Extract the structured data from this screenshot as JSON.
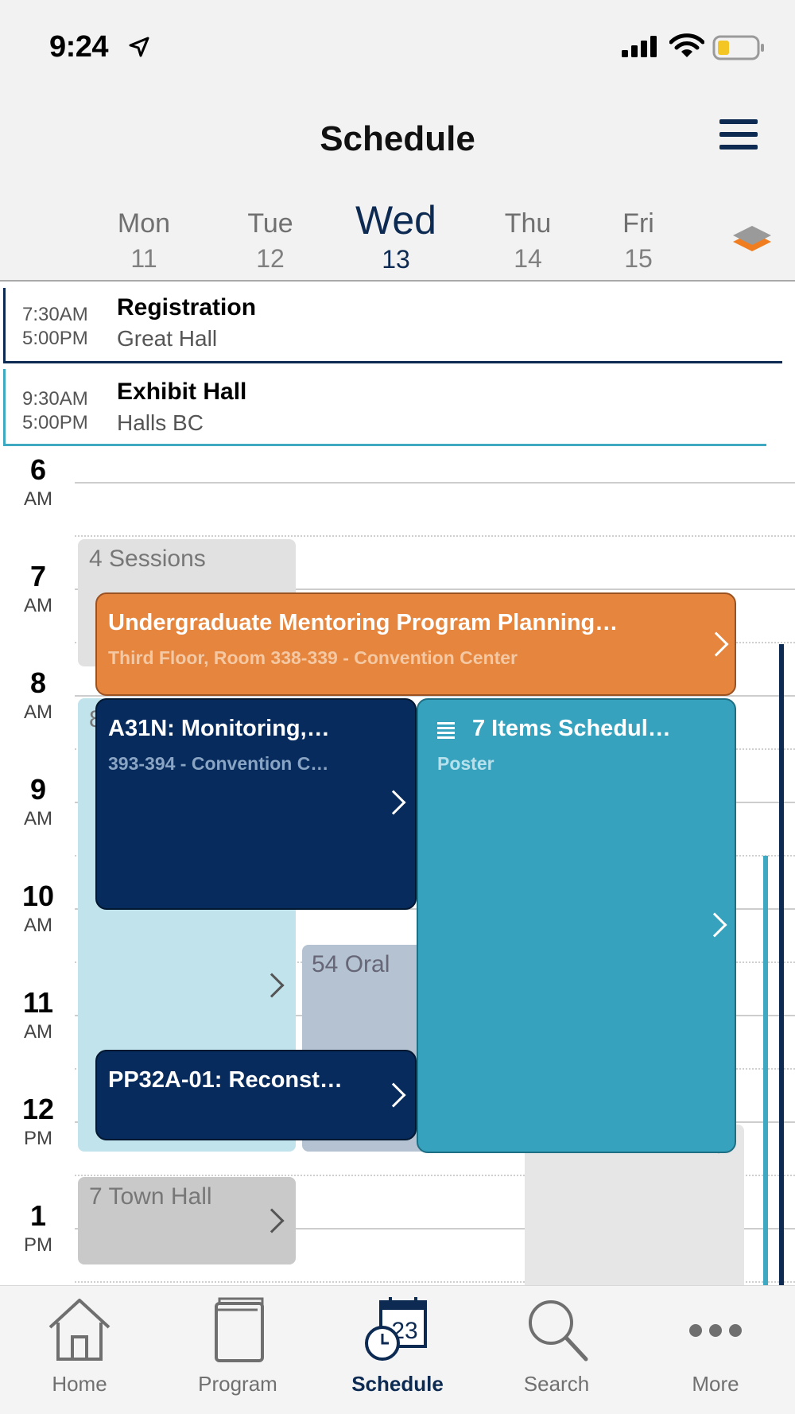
{
  "status_bar": {
    "time": "9:24"
  },
  "header": {
    "title": "Schedule"
  },
  "days": [
    {
      "name": "Mon",
      "date": "11"
    },
    {
      "name": "Tue",
      "date": "12"
    },
    {
      "name": "Wed",
      "date": "13",
      "selected": true
    },
    {
      "name": "Thu",
      "date": "14"
    },
    {
      "name": "Fri",
      "date": "15"
    }
  ],
  "all_day_events": [
    {
      "start": "7:30AM",
      "end": "5:00PM",
      "title": "Registration",
      "location": "Great Hall",
      "color": "#0c2a52"
    },
    {
      "start": "9:30AM",
      "end": "5:00PM",
      "title": "Exhibit Hall",
      "location": "Halls BC",
      "color": "#3fa9c2"
    }
  ],
  "hours": [
    {
      "hour": "6",
      "ampm": "AM"
    },
    {
      "hour": "7",
      "ampm": "AM"
    },
    {
      "hour": "8",
      "ampm": "AM"
    },
    {
      "hour": "9",
      "ampm": "AM"
    },
    {
      "hour": "10",
      "ampm": "AM"
    },
    {
      "hour": "11",
      "ampm": "AM"
    },
    {
      "hour": "12",
      "ampm": "PM"
    },
    {
      "hour": "1",
      "ampm": "PM"
    }
  ],
  "session_groups": {
    "sessions": "4 Sessions",
    "partial": "8",
    "oral": "54 Oral",
    "town_hall": "7 Town Hall"
  },
  "events": {
    "mentoring": {
      "title": "Undergraduate Mentoring Program Planning…",
      "subtitle": "Third Floor, Room 338-339 - Convention Center",
      "color": "#e5853e"
    },
    "a31n": {
      "title": "A31N: Monitoring,…",
      "subtitle": "393-394 - Convention C…",
      "color": "#062b5c"
    },
    "poster": {
      "title": "7 Items Schedul…",
      "subtitle": "Poster",
      "color": "#36a2bd"
    },
    "pp32a": {
      "title": "PP32A-01: Reconst…",
      "color": "#062b5c"
    }
  },
  "tabs": [
    {
      "label": "Home"
    },
    {
      "label": "Program"
    },
    {
      "label": "Schedule",
      "active": true
    },
    {
      "label": "Search"
    },
    {
      "label": "More"
    }
  ],
  "calendar_icon_day": "23",
  "colors": {
    "accent": "#0c2a52",
    "layers_orange": "#f07e20",
    "layers_gray": "#9a9a9a"
  }
}
